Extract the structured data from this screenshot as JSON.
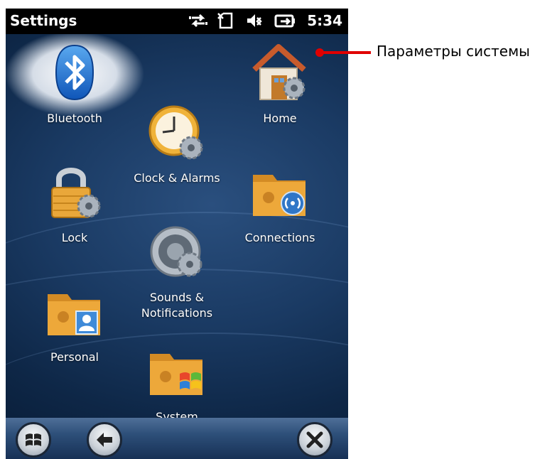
{
  "status_bar": {
    "title": "Settings",
    "time": "5:34",
    "icons": [
      "sync-arrows-icon",
      "no-sim-icon",
      "speaker-muted-icon",
      "battery-charging-icon"
    ]
  },
  "apps": [
    {
      "name": "bluetooth",
      "label": "Bluetooth",
      "icon": "bluetooth-icon",
      "selected": true
    },
    {
      "name": "home",
      "label": "Home",
      "icon": "house-gear-icon"
    },
    {
      "name": "clock-alarms",
      "label": "Clock & Alarms",
      "icon": "clock-gear-icon"
    },
    {
      "name": "lock",
      "label": "Lock",
      "icon": "padlock-gear-icon"
    },
    {
      "name": "connections",
      "label": "Connections",
      "icon": "folder-wireless-icon"
    },
    {
      "name": "sounds-notifications",
      "label_line1": "Sounds &",
      "label_line2": "Notifications",
      "icon": "speaker-gear-icon"
    },
    {
      "name": "personal",
      "label": "Personal",
      "icon": "folder-contact-icon"
    },
    {
      "name": "system",
      "label": "System",
      "icon": "folder-windows-icon"
    }
  ],
  "taskbar": {
    "buttons": [
      "windows-start-icon",
      "back-arrow-icon",
      "close-x-icon"
    ]
  },
  "annotation": {
    "text": "Параметры системы",
    "color": "#e00000"
  },
  "colors": {
    "background": "#1a3a63",
    "statusbar": "#000000",
    "folder": "#e8a235"
  }
}
